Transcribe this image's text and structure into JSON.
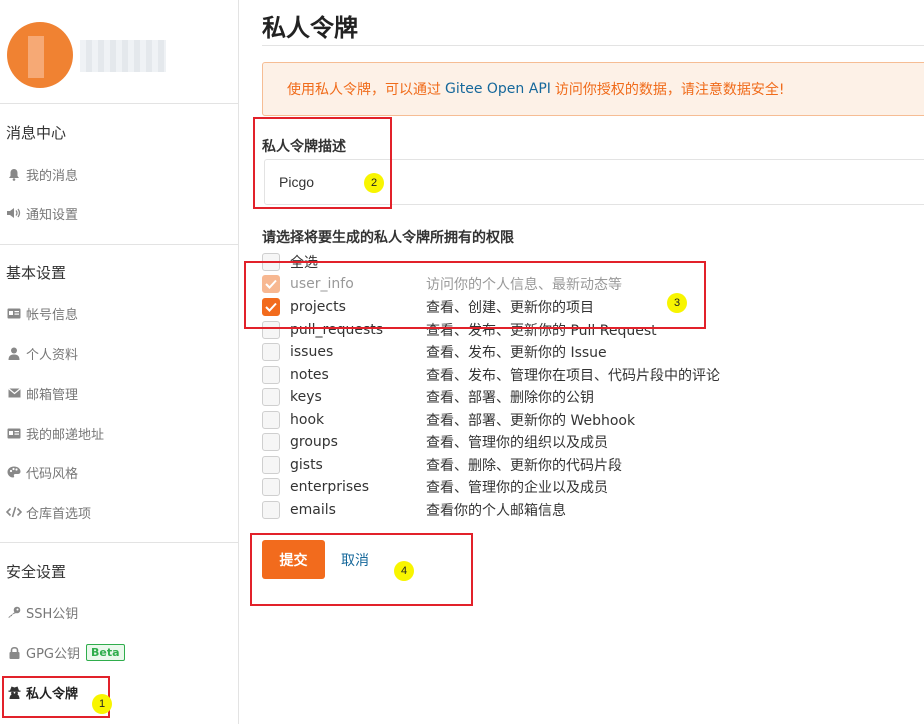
{
  "sidebar": {
    "sections": [
      {
        "title": "消息中心",
        "items": [
          {
            "label": "我的消息",
            "icon": "bell-icon"
          },
          {
            "label": "通知设置",
            "icon": "speaker-icon"
          }
        ]
      },
      {
        "title": "基本设置",
        "items": [
          {
            "label": "帐号信息",
            "icon": "id-card-icon"
          },
          {
            "label": "个人资料",
            "icon": "user-icon"
          },
          {
            "label": "邮箱管理",
            "icon": "envelope-icon"
          },
          {
            "label": "我的邮递地址",
            "icon": "address-card-icon"
          },
          {
            "label": "代码风格",
            "icon": "palette-icon"
          },
          {
            "label": "仓库首选项",
            "icon": "code-icon"
          }
        ]
      },
      {
        "title": "安全设置",
        "items": [
          {
            "label": "SSH公钥",
            "icon": "key-icon"
          },
          {
            "label": "GPG公钥",
            "icon": "lock-icon",
            "badge": "Beta"
          },
          {
            "label": "私人令牌",
            "icon": "spy-icon",
            "active": true
          }
        ]
      }
    ]
  },
  "main": {
    "title": "私人令牌",
    "alert": {
      "before": "使用私人令牌，可以通过",
      "api": "Gitee Open API",
      "after": "访问你授权的数据，请注意数据安全!"
    },
    "description_label": "私人令牌描述",
    "description_value": "Picgo",
    "permissions_label": "请选择将要生成的私人令牌所拥有的权限",
    "select_all": "全选",
    "permissions": [
      {
        "name": "user_info",
        "desc": "访问你的个人信息、最新动态等",
        "checked": true,
        "disabled": true
      },
      {
        "name": "projects",
        "desc": "查看、创建、更新你的项目",
        "checked": true,
        "disabled": false
      },
      {
        "name": "pull_requests",
        "desc": "查看、发布、更新你的 Pull Request",
        "checked": false
      },
      {
        "name": "issues",
        "desc": "查看、发布、更新你的 Issue",
        "checked": false
      },
      {
        "name": "notes",
        "desc": "查看、发布、管理你在项目、代码片段中的评论",
        "checked": false
      },
      {
        "name": "keys",
        "desc": "查看、部署、删除你的公钥",
        "checked": false
      },
      {
        "name": "hook",
        "desc": "查看、部署、更新你的 Webhook",
        "checked": false
      },
      {
        "name": "groups",
        "desc": "查看、管理你的组织以及成员",
        "checked": false
      },
      {
        "name": "gists",
        "desc": "查看、删除、更新你的代码片段",
        "checked": false
      },
      {
        "name": "enterprises",
        "desc": "查看、管理你的企业以及成员",
        "checked": false
      },
      {
        "name": "emails",
        "desc": "查看你的个人邮箱信息",
        "checked": false
      }
    ],
    "submit_label": "提交",
    "cancel_label": "取消"
  },
  "annotations": [
    "1",
    "2",
    "3",
    "4"
  ],
  "colors": {
    "accent": "#f26b1d",
    "link": "#16689b",
    "annotation_box": "#e2212a",
    "annotation_marker": "#f8f500"
  }
}
